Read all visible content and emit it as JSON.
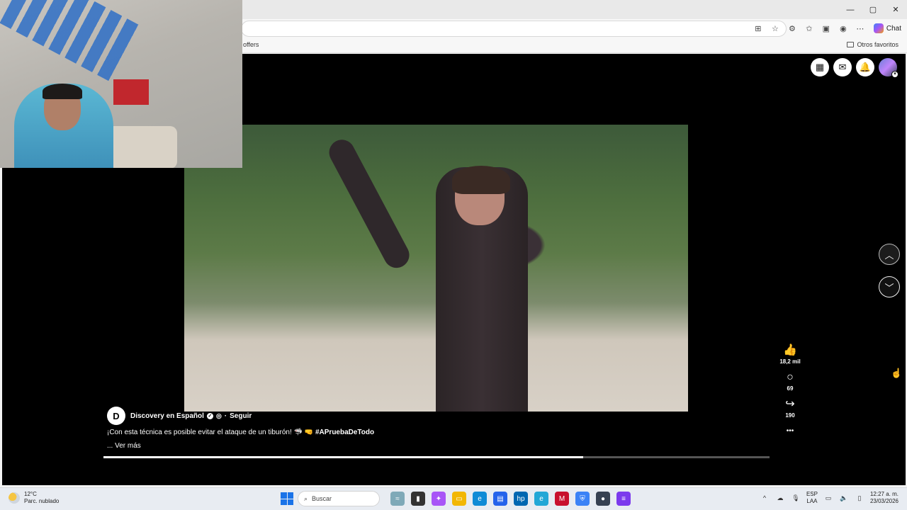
{
  "browser": {
    "window_controls": {
      "minimize": "—",
      "maximize": "▢",
      "close": "✕"
    },
    "toolbar": {
      "chat_label": "Chat",
      "more_icon": "⋯"
    },
    "favorites": {
      "partial_item": "offers",
      "folder_label": "Otros favoritos"
    }
  },
  "page": {
    "top_icons": {
      "apps": "▦",
      "messenger": "✉",
      "notifications": "🔔"
    },
    "nav": {
      "up": "︿",
      "down": "﹀"
    },
    "actions": {
      "likes_icon": "👍",
      "likes": "18,2 mil",
      "comments_icon": "○",
      "comments": "69",
      "shares_icon": "↪",
      "shares": "190",
      "more_icon": "•••"
    },
    "post": {
      "channel_initial": "D",
      "channel_name": "Discovery en Español",
      "verified_icon": "✓",
      "globe_icon": "◎",
      "separator": "·",
      "follow_label": "Seguir",
      "caption_text": "¡Con esta técnica es posible evitar el ataque de un tiburón! 🦈 🤜",
      "hashtag": "#APruebaDeTodo",
      "see_more": "... Ver más"
    },
    "progress": 0.72
  },
  "taskbar": {
    "weather": {
      "temp": "12°C",
      "desc": "Parc. nublado"
    },
    "search_placeholder": "Buscar",
    "search_icon": "⌕",
    "apps": [
      {
        "name": "widgets",
        "glyph": "≈",
        "color": "#7fa9b8"
      },
      {
        "name": "terminal",
        "glyph": "▮",
        "color": "#333333"
      },
      {
        "name": "copilot",
        "glyph": "✦",
        "color": "#a855f7"
      },
      {
        "name": "file-explorer",
        "glyph": "▭",
        "color": "#f2b705"
      },
      {
        "name": "edge",
        "glyph": "e",
        "color": "#0f8bd6"
      },
      {
        "name": "store",
        "glyph": "▤",
        "color": "#2563eb"
      },
      {
        "name": "hp",
        "glyph": "hp",
        "color": "#0067b1"
      },
      {
        "name": "edge-beta",
        "glyph": "e",
        "color": "#22a7d6"
      },
      {
        "name": "mcafee",
        "glyph": "M",
        "color": "#c8102e"
      },
      {
        "name": "shield-app",
        "glyph": "⛨",
        "color": "#3b82f6"
      },
      {
        "name": "media-app",
        "glyph": "●",
        "color": "#374151"
      },
      {
        "name": "purple-app",
        "glyph": "≡",
        "color": "#7c3aed"
      }
    ],
    "tray": {
      "chevron": "^",
      "lang_top": "ESP",
      "lang_bottom": "LAA",
      "time": "12:27 a. m.",
      "date": "23/03/2026"
    }
  }
}
